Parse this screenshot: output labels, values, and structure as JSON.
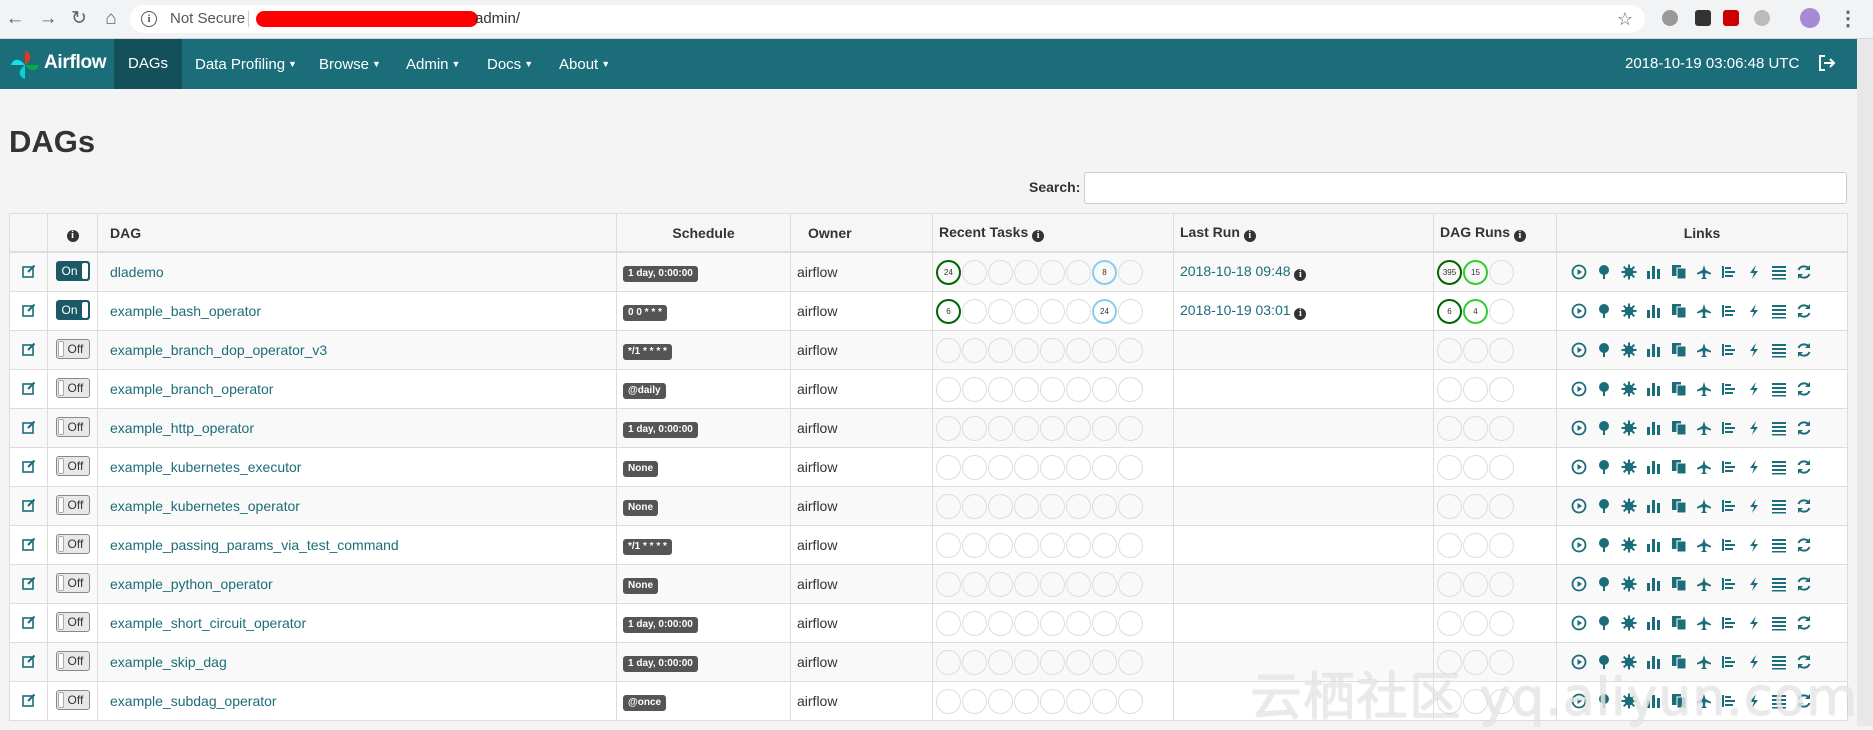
{
  "browser": {
    "security_label": "Not Secure",
    "url_path": "admin/"
  },
  "navbar": {
    "brand": "Airflow",
    "items": [
      {
        "label": "DAGs",
        "active": true,
        "dropdown": false
      },
      {
        "label": "Data Profiling",
        "dropdown": true
      },
      {
        "label": "Browse",
        "dropdown": true
      },
      {
        "label": "Admin",
        "dropdown": true
      },
      {
        "label": "Docs",
        "dropdown": true
      },
      {
        "label": "About",
        "dropdown": true
      }
    ],
    "clock": "2018-10-19 03:06:48 UTC"
  },
  "page": {
    "title": "DAGs",
    "search_label": "Search:",
    "search_value": ""
  },
  "table": {
    "headers": {
      "info": "i",
      "dag": "DAG",
      "schedule": "Schedule",
      "owner": "Owner",
      "recent_tasks": "Recent Tasks",
      "last_run": "Last Run",
      "dag_runs": "DAG Runs",
      "links": "Links"
    },
    "rows": [
      {
        "toggle": "On",
        "dag_id": "dlademo",
        "schedule": "1 day, 0:00:00",
        "owner": "airflow",
        "last_run": "2018-10-18 09:48",
        "recent_tasks": [
          "24",
          "",
          "",
          "",
          "",
          "",
          "8",
          ""
        ],
        "recent_task_states": [
          "success",
          "",
          "",
          "",
          "",
          "",
          "skipped",
          ""
        ],
        "dag_runs": [
          "395",
          "15",
          ""
        ],
        "dag_run_states": [
          "success",
          "running",
          ""
        ]
      },
      {
        "toggle": "On",
        "dag_id": "example_bash_operator",
        "schedule": "0 0 * * *",
        "owner": "airflow",
        "last_run": "2018-10-19 03:01",
        "recent_tasks": [
          "6",
          "",
          "",
          "",
          "",
          "",
          "24",
          ""
        ],
        "recent_task_states": [
          "success",
          "",
          "",
          "",
          "",
          "",
          "skipped",
          ""
        ],
        "dag_runs": [
          "6",
          "4",
          ""
        ],
        "dag_run_states": [
          "success",
          "running",
          ""
        ]
      },
      {
        "toggle": "Off",
        "dag_id": "example_branch_dop_operator_v3",
        "schedule": "*/1 * * * *",
        "owner": "airflow",
        "last_run": ""
      },
      {
        "toggle": "Off",
        "dag_id": "example_branch_operator",
        "schedule": "@daily",
        "owner": "airflow",
        "last_run": ""
      },
      {
        "toggle": "Off",
        "dag_id": "example_http_operator",
        "schedule": "1 day, 0:00:00",
        "owner": "airflow",
        "last_run": ""
      },
      {
        "toggle": "Off",
        "dag_id": "example_kubernetes_executor",
        "schedule": "None",
        "owner": "airflow",
        "last_run": ""
      },
      {
        "toggle": "Off",
        "dag_id": "example_kubernetes_operator",
        "schedule": "None",
        "owner": "airflow",
        "last_run": ""
      },
      {
        "toggle": "Off",
        "dag_id": "example_passing_params_via_test_command",
        "schedule": "*/1 * * * *",
        "owner": "airflow",
        "last_run": ""
      },
      {
        "toggle": "Off",
        "dag_id": "example_python_operator",
        "schedule": "None",
        "owner": "airflow",
        "last_run": ""
      },
      {
        "toggle": "Off",
        "dag_id": "example_short_circuit_operator",
        "schedule": "1 day, 0:00:00",
        "owner": "airflow",
        "last_run": ""
      },
      {
        "toggle": "Off",
        "dag_id": "example_skip_dag",
        "schedule": "1 day, 0:00:00",
        "owner": "airflow",
        "last_run": ""
      },
      {
        "toggle": "Off",
        "dag_id": "example_subdag_operator",
        "schedule": "@once",
        "owner": "airflow",
        "last_run": ""
      }
    ],
    "link_icons": [
      "trigger-dag-icon",
      "tree-view-icon",
      "graph-view-icon",
      "task-duration-icon",
      "task-tries-icon",
      "landing-times-icon",
      "gantt-icon",
      "code-view-icon",
      "logs-icon",
      "refresh-icon",
      "delete-icon"
    ]
  },
  "colors": {
    "navbar": "#1c6d7a",
    "link": "#1c6d7a",
    "success": "#006400",
    "running": "#32cd32",
    "skipped": "#87ceeb"
  },
  "watermark": "云栖社区 yq.aliyun.com"
}
